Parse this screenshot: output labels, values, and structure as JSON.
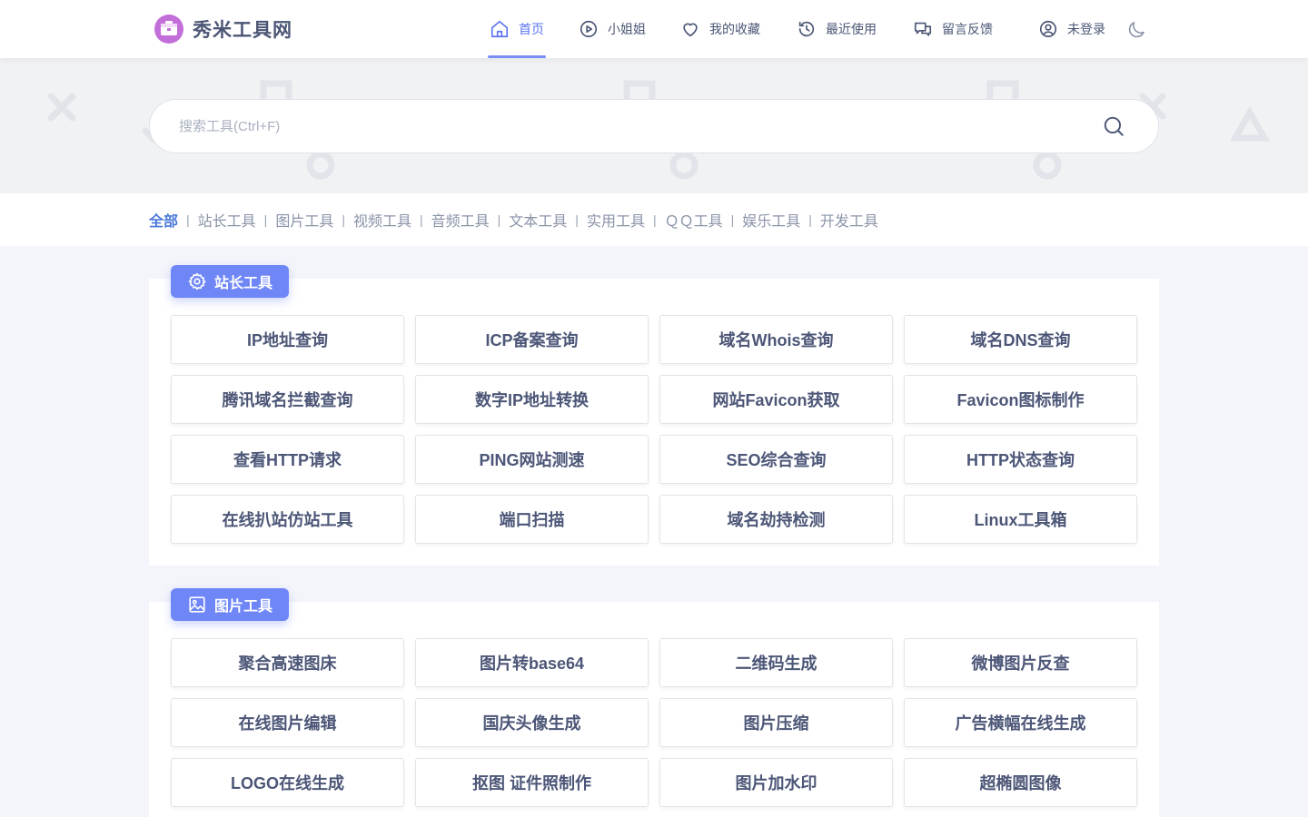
{
  "site": {
    "name": "秀米工具网"
  },
  "nav": [
    {
      "label": "首页",
      "icon": "home-icon",
      "active": true
    },
    {
      "label": "小姐姐",
      "icon": "play-icon",
      "active": false
    },
    {
      "label": "我的收藏",
      "icon": "heart-icon",
      "active": false
    },
    {
      "label": "最近使用",
      "icon": "history-icon",
      "active": false
    },
    {
      "label": "留言反馈",
      "icon": "chat-icon",
      "active": false
    },
    {
      "label": "未登录",
      "icon": "user-icon",
      "active": false
    }
  ],
  "theme_toggle_icon": "moon-icon",
  "search": {
    "placeholder": "搜索工具(Ctrl+F)",
    "value": ""
  },
  "categories": [
    "全部",
    "站长工具",
    "图片工具",
    "视频工具",
    "音频工具",
    "文本工具",
    "实用工具",
    "ＱＱ工具",
    "娱乐工具",
    "开发工具"
  ],
  "active_category": "全部",
  "sections": [
    {
      "title": "站长工具",
      "icon": "gear-icon",
      "tools": [
        "IP地址查询",
        "ICP备案查询",
        "域名Whois查询",
        "域名DNS查询",
        "腾讯域名拦截查询",
        "数字IP地址转换",
        "网站Favicon获取",
        "Favicon图标制作",
        "查看HTTP请求",
        "PING网站测速",
        "SEO综合查询",
        "HTTP状态查询",
        "在线扒站仿站工具",
        "端口扫描",
        "域名劫持检测",
        "Linux工具箱"
      ]
    },
    {
      "title": "图片工具",
      "icon": "image-icon",
      "tools": [
        "聚合高速图床",
        "图片转base64",
        "二维码生成",
        "微博图片反查",
        "在线图片编辑",
        "国庆头像生成",
        "图片压缩",
        "广告横幅在线生成",
        "LOGO在线生成",
        "抠图 证件照制作",
        "图片加水印",
        "超椭圆图像"
      ]
    }
  ],
  "colors": {
    "accent": "#6f86f7",
    "nav_active": "#5b74f2",
    "category_active": "#4a78d8",
    "text": "#4b5675"
  }
}
